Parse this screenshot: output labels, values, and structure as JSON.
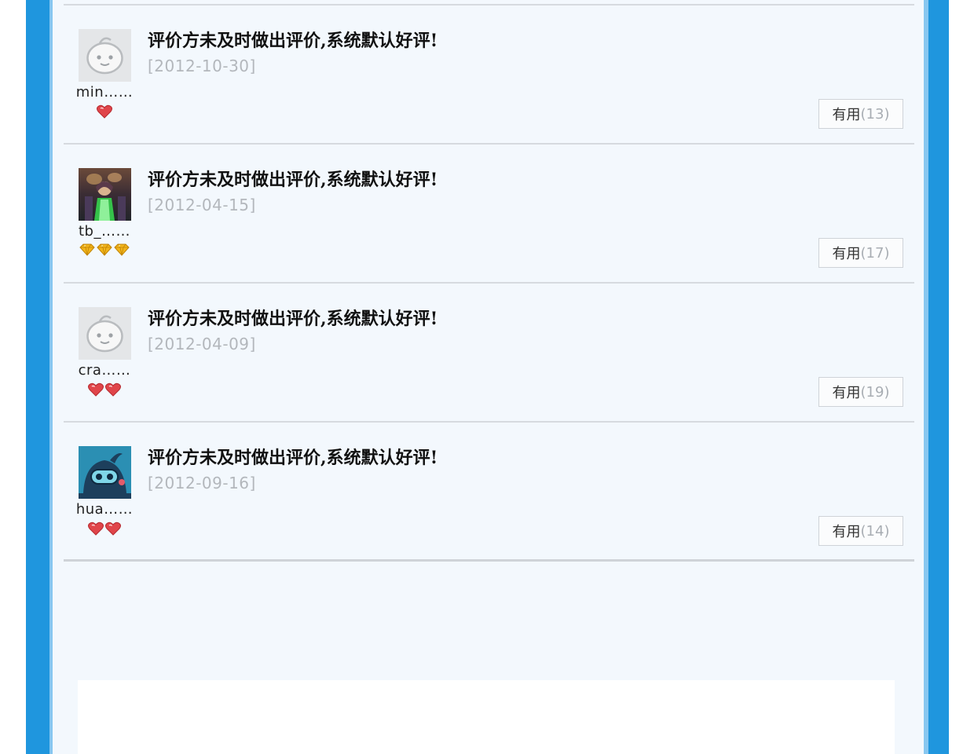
{
  "colors": {
    "frame_blue": "#1f96de",
    "frame_light": "#88c7f0",
    "panel_bg": "#f3f8fd",
    "divider": "#d6dadf",
    "date_gray": "#b3b7bc",
    "heart_red": "#e0454a",
    "diamond_yellow": "#f2b51a"
  },
  "reviews": [
    {
      "avatar_icon": "default-avatar-icon",
      "username": "min……",
      "rank_icon": "red-heart-icon",
      "rank_count": 1,
      "comment": "评价方未及时做出评价,系统默认好评!",
      "date": "[2012-10-30]",
      "useful_label": "有用",
      "useful_count": "(13)"
    },
    {
      "avatar_icon": "photo-avatar-icon",
      "username": "tb_……",
      "rank_icon": "yellow-diamond-icon",
      "rank_count": 3,
      "comment": "评价方未及时做出评价,系统默认好评!",
      "date": "[2012-04-15]",
      "useful_label": "有用",
      "useful_count": "(17)"
    },
    {
      "avatar_icon": "default-avatar-icon",
      "username": "cra……",
      "rank_icon": "red-heart-icon",
      "rank_count": 2,
      "comment": "评价方未及时做出评价,系统默认好评!",
      "date": "[2012-04-09]",
      "useful_label": "有用",
      "useful_count": "(19)"
    },
    {
      "avatar_icon": "cartoon-avatar-icon",
      "username": "hua……",
      "rank_icon": "red-heart-icon",
      "rank_count": 2,
      "comment": "评价方未及时做出评价,系统默认好评!",
      "date": "[2012-09-16]",
      "useful_label": "有用",
      "useful_count": "(14)"
    }
  ]
}
